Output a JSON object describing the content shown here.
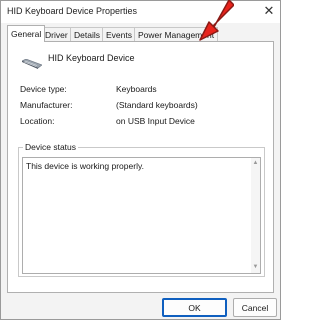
{
  "window": {
    "title": "HID Keyboard Device Properties",
    "close_glyph": "✕"
  },
  "tabs": [
    {
      "label": "General",
      "active": true
    },
    {
      "label": "Driver",
      "active": false
    },
    {
      "label": "Details",
      "active": false
    },
    {
      "label": "Events",
      "active": false
    },
    {
      "label": "Power Management",
      "active": false
    }
  ],
  "device": {
    "icon": "keyboard-icon",
    "name": "HID Keyboard Device",
    "properties": [
      {
        "label": "Device type:",
        "value": "Keyboards"
      },
      {
        "label": "Manufacturer:",
        "value": "(Standard keyboards)"
      },
      {
        "label": "Location:",
        "value": "on USB Input Device"
      }
    ]
  },
  "device_status": {
    "title": "Device status",
    "text": "This device is working properly."
  },
  "buttons": {
    "ok": "OK",
    "cancel": "Cancel"
  },
  "annotation": {
    "icon": "red-arrow-icon",
    "color": "#e8231c"
  }
}
